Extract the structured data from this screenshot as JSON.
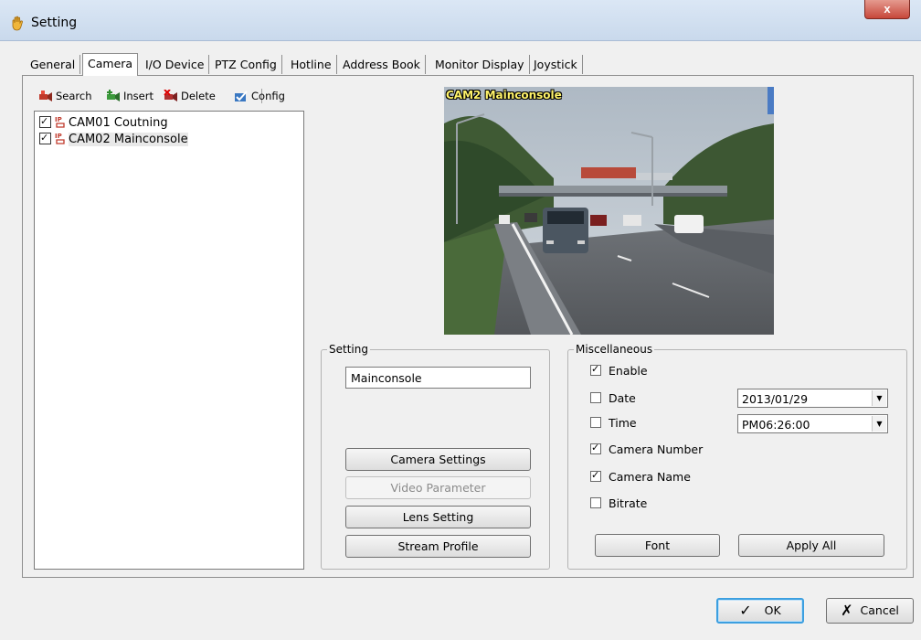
{
  "window": {
    "title": "Setting",
    "close_glyph": "x"
  },
  "tabs": [
    {
      "label": "General",
      "active": false
    },
    {
      "label": "Camera",
      "active": true
    },
    {
      "label": "I/O Device",
      "active": false
    },
    {
      "label": "PTZ Config",
      "active": false
    },
    {
      "label": "Hotline",
      "active": false
    },
    {
      "label": "Address Book",
      "active": false
    },
    {
      "label": "Monitor Display",
      "active": false
    },
    {
      "label": "Joystick",
      "active": false
    }
  ],
  "toolbar": {
    "search": "Search",
    "insert": "Insert",
    "delete": "Delete",
    "config": "Config"
  },
  "camera_tree": [
    {
      "label": "CAM01 Coutning",
      "checked": true,
      "icon": "ip-camera-icon"
    },
    {
      "label": "CAM02 Mainconsole",
      "checked": true,
      "icon": "ip-camera-icon",
      "selected": true
    }
  ],
  "preview": {
    "osd_text": "CAM2 Mainconsole"
  },
  "setting": {
    "legend": "Setting",
    "name_value": "Mainconsole",
    "buttons": {
      "camera_settings": "Camera Settings",
      "video_parameter": "Video Parameter",
      "lens_setting": "Lens Setting",
      "stream_profile": "Stream Profile"
    }
  },
  "misc": {
    "legend": "Miscellaneous",
    "enable": {
      "label": "Enable",
      "checked": true
    },
    "date": {
      "label": "Date",
      "checked": false,
      "value": "2013/01/29"
    },
    "time": {
      "label": "Time",
      "checked": false,
      "value": "PM06:26:00"
    },
    "camera_number": {
      "label": "Camera Number",
      "checked": true
    },
    "camera_name": {
      "label": "Camera Name",
      "checked": true
    },
    "bitrate": {
      "label": "Bitrate",
      "checked": false
    },
    "font_button": "Font",
    "apply_all_button": "Apply All"
  },
  "footer": {
    "ok": "OK",
    "cancel": "Cancel",
    "ok_glyph": "✓",
    "cancel_glyph": "✗"
  },
  "colors": {
    "accent_focus": "#3c9fe0",
    "close_button": "#c7473a",
    "osd_text": "#fff36a"
  }
}
